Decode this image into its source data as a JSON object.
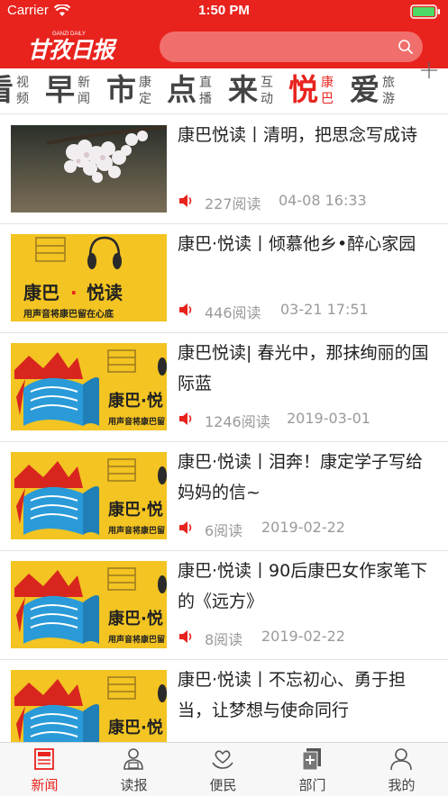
{
  "status": {
    "carrier": "Carrier",
    "time": "1:50 PM"
  },
  "header": {
    "logo_text": "甘孜日报",
    "logo_sub": "GANZI DAILY",
    "search_placeholder": ""
  },
  "colors": {
    "brand_red": "#e8231e",
    "meta_gray": "#9a9a9a",
    "thumb_yellow": "#f3c422"
  },
  "channels": [
    {
      "big": "看",
      "small": "视频",
      "active": false
    },
    {
      "big": "早",
      "small": "新闻",
      "active": false
    },
    {
      "big": "市",
      "small": "康定",
      "active": false
    },
    {
      "big": "点",
      "small": "直播",
      "active": false
    },
    {
      "big": "来",
      "small": "互动",
      "active": false
    },
    {
      "big": "悦",
      "small": "康巴",
      "active": true
    },
    {
      "big": "爱",
      "small": "旅游",
      "active": false
    }
  ],
  "thumb_text": {
    "kangba": "康巴",
    "dot": "·",
    "yuedu": "悦读",
    "slogan": "用声音将康巴留在心底",
    "kangba_short": "康巴·悦",
    "slogan_short": "用声音将康巴留"
  },
  "news": [
    {
      "title": "康巴悦读丨清明，把思念写成诗",
      "reads": "227阅读",
      "date": "04-08 16:33",
      "thumb": "blossom"
    },
    {
      "title": "康巴·悦读丨倾慕他乡•醉心家园",
      "reads": "446阅读",
      "date": "03-21 17:51",
      "thumb": "banner"
    },
    {
      "title": "康巴悦读| 春光中，那抹绚丽的国际蓝",
      "reads": "1246阅读",
      "date": "2019-03-01",
      "thumb": "book"
    },
    {
      "title": "康巴·悦读丨泪奔！康定学子写给妈妈的信~",
      "reads": "6阅读",
      "date": "2019-02-22",
      "thumb": "book"
    },
    {
      "title": "康巴·悦读丨90后康巴女作家笔下的《远方》",
      "reads": "8阅读",
      "date": "2019-02-22",
      "thumb": "book"
    },
    {
      "title": "康巴·悦读丨不忘初心、勇于担当，让梦想与使命同行",
      "reads": "",
      "date": "",
      "thumb": "book"
    }
  ],
  "tabs": [
    {
      "label": "新闻",
      "icon": "newspaper-icon",
      "active": true
    },
    {
      "label": "读报",
      "icon": "reader-icon",
      "active": false
    },
    {
      "label": "便民",
      "icon": "service-icon",
      "active": false
    },
    {
      "label": "部门",
      "icon": "department-icon",
      "active": false
    },
    {
      "label": "我的",
      "icon": "profile-icon",
      "active": false
    }
  ]
}
